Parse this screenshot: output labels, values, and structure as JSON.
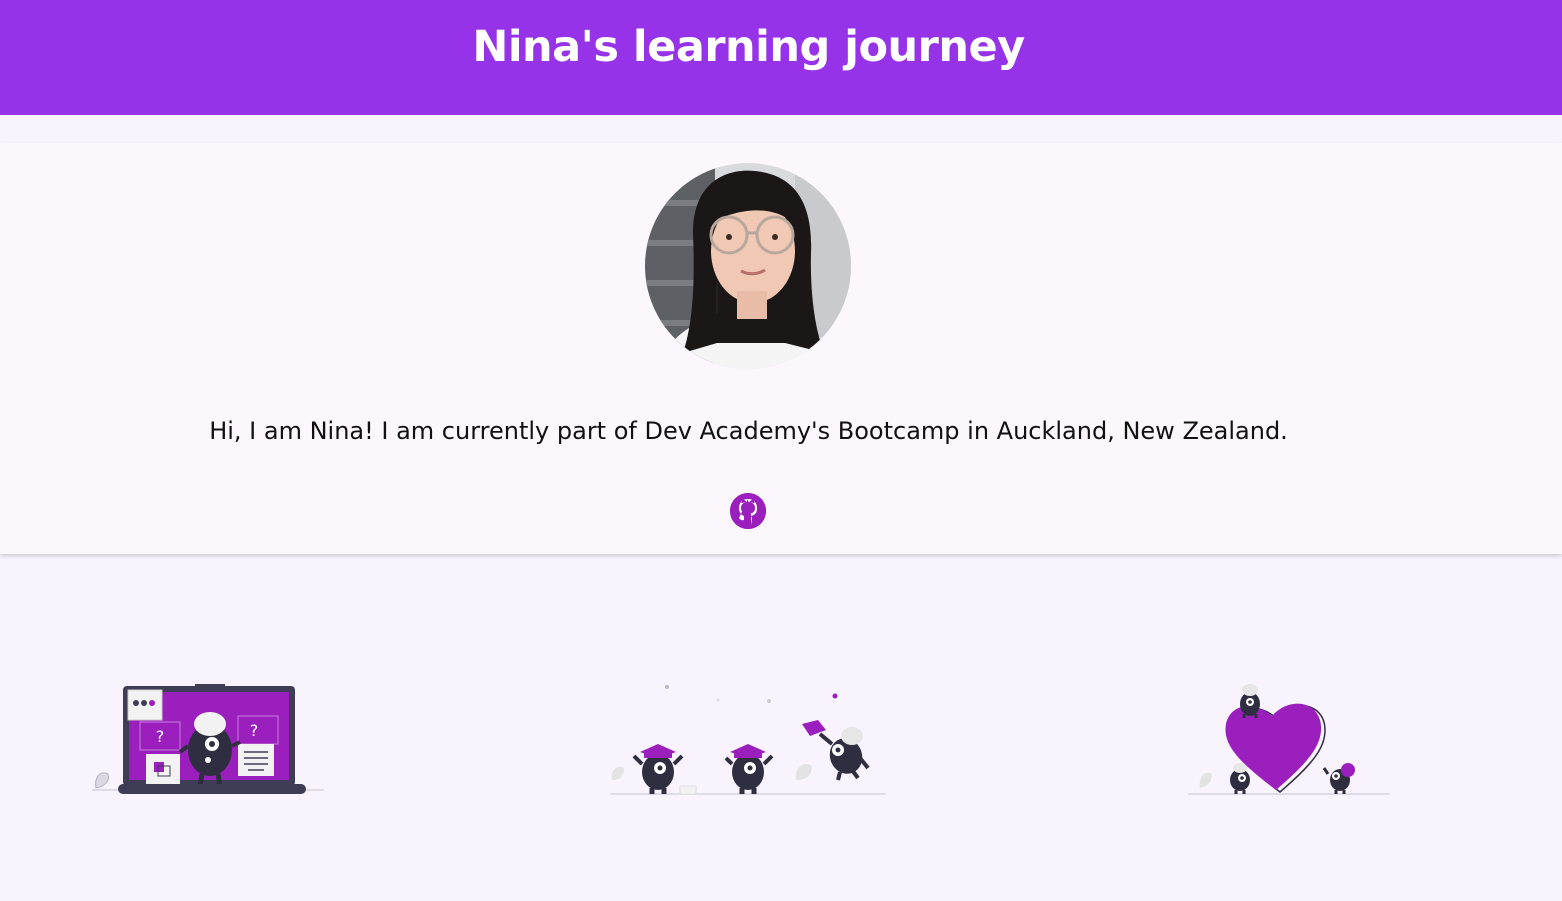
{
  "header": {
    "title": "Nina's learning journey"
  },
  "profile": {
    "avatar_icon": "profile-photo",
    "bio": "Hi, I am Nina! I am currently part of Dev Academy's Bootcamp in Auckland, New Zealand.",
    "github_icon": "github-icon"
  },
  "illustrations": [
    {
      "icon": "laptop-monster-illustration"
    },
    {
      "icon": "graduation-monsters-illustration"
    },
    {
      "icon": "heart-monsters-illustration"
    }
  ],
  "colors": {
    "header_bg": "#9633e8",
    "accent": "#9b1fbd",
    "page_bg": "#f9f3fd",
    "text": "#111111"
  }
}
